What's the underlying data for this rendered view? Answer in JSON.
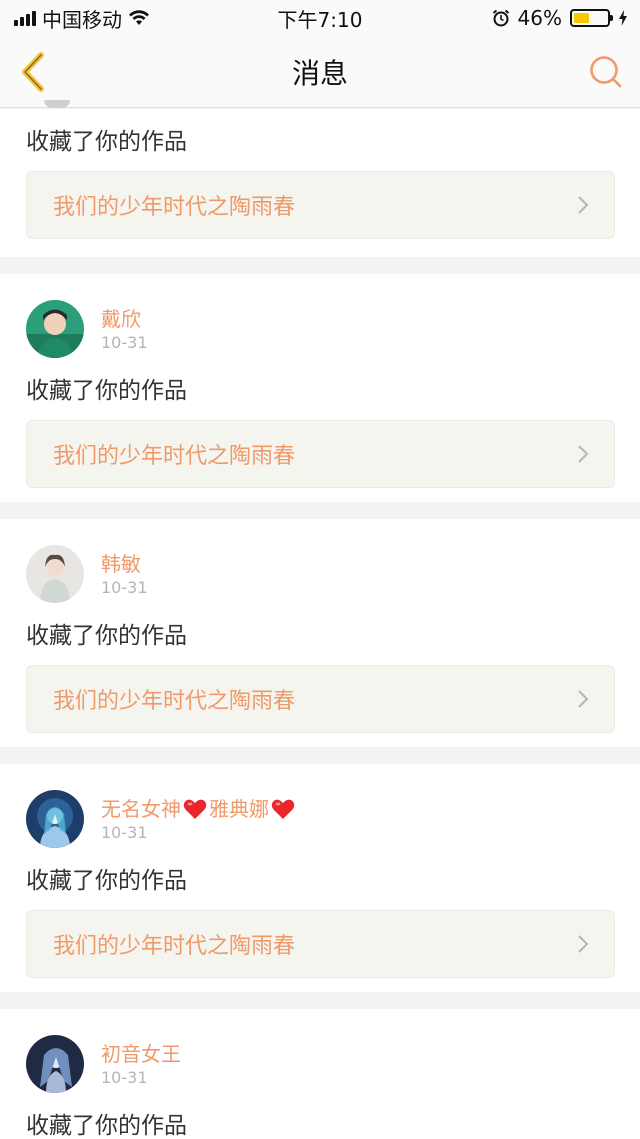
{
  "status_bar": {
    "carrier": "中国移动",
    "time": "下午7:10",
    "battery_percent": "46%",
    "battery_level": 0.46,
    "icons": [
      "signal-icon",
      "wifi-icon",
      "alarm-icon",
      "battery-icon",
      "charging-icon"
    ]
  },
  "nav": {
    "title": "消息",
    "back_icon": "chevron-left-icon",
    "search_icon": "search-icon",
    "accent_color": "#f09a6b"
  },
  "notifications": [
    {
      "action": "收藏了你的作品",
      "work": "我们的少年时代之陶雨春"
    },
    {
      "name": "戴欣",
      "date": "10-31",
      "action": "收藏了你的作品",
      "work": "我们的少年时代之陶雨春"
    },
    {
      "name": "韩敏",
      "date": "10-31",
      "action": "收藏了你的作品",
      "work": "我们的少年时代之陶雨春"
    },
    {
      "name_parts": [
        "无名女神",
        "雅典娜"
      ],
      "date": "10-31",
      "action": "收藏了你的作品",
      "work": "我们的少年时代之陶雨春"
    },
    {
      "name": "初音女王",
      "date": "10-31",
      "action": "收藏了你的作品"
    }
  ]
}
